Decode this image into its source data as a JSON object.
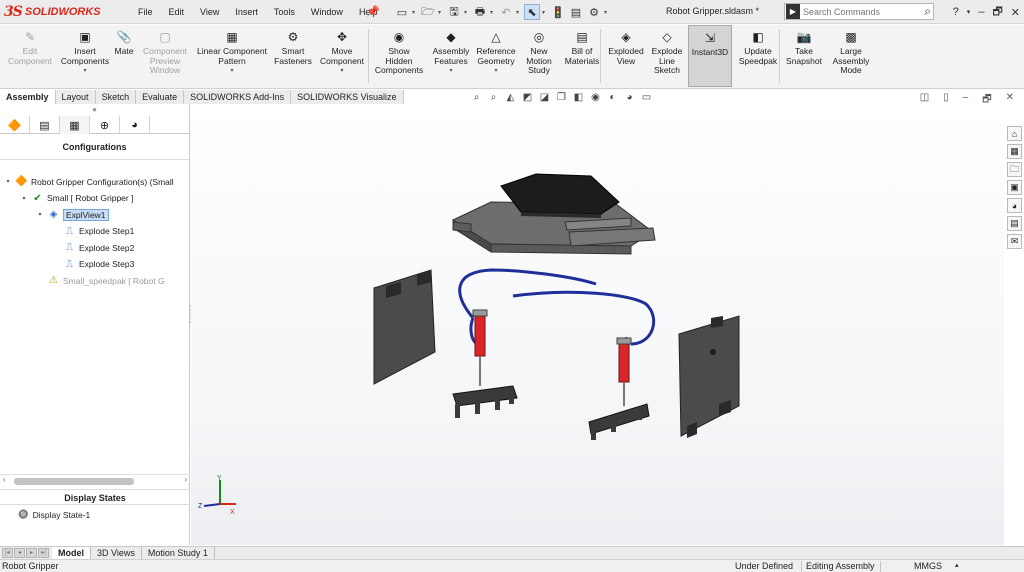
{
  "app": {
    "brand": "SOLIDWORKS",
    "document_title": "Robot Gripper.sldasm *"
  },
  "menu": [
    "File",
    "Edit",
    "View",
    "Insert",
    "Tools",
    "Window",
    "Help"
  ],
  "search": {
    "placeholder": "Search Commands"
  },
  "ribbon": [
    {
      "id": "edit-component",
      "label": "Edit Component",
      "lines": [
        "Edit",
        "Component"
      ],
      "disabled": true,
      "icon": "edit-component-icon"
    },
    {
      "id": "insert-components",
      "label": "Insert Components",
      "lines": [
        "Insert",
        "Components"
      ],
      "disabled": false,
      "icon": "insert-components-icon",
      "dropdown": true
    },
    {
      "id": "mate",
      "label": "Mate",
      "lines": [
        "Mate"
      ],
      "disabled": false,
      "icon": "paperclip-icon"
    },
    {
      "id": "component-preview",
      "label": "Component Preview Window",
      "lines": [
        "Component",
        "Preview",
        "Window"
      ],
      "disabled": true,
      "icon": "preview-window-icon"
    },
    {
      "id": "linear-pattern",
      "label": "Linear Component Pattern",
      "lines": [
        "Linear Component",
        "Pattern"
      ],
      "disabled": false,
      "icon": "linear-pattern-icon",
      "dropdown": true
    },
    {
      "id": "smart-fasteners",
      "label": "Smart Fasteners",
      "lines": [
        "Smart",
        "Fasteners"
      ],
      "disabled": false,
      "icon": "fastener-icon"
    },
    {
      "id": "move-component",
      "label": "Move Component",
      "lines": [
        "Move",
        "Component"
      ],
      "disabled": false,
      "icon": "move-component-icon",
      "dropdown": true
    },
    {
      "id": "show-hidden",
      "label": "Show Hidden Components",
      "lines": [
        "Show",
        "Hidden",
        "Components"
      ],
      "disabled": false,
      "icon": "show-hidden-icon"
    },
    {
      "id": "assembly-features",
      "label": "Assembly Features",
      "lines": [
        "Assembly",
        "Features"
      ],
      "disabled": false,
      "icon": "assembly-features-icon",
      "dropdown": true
    },
    {
      "id": "reference-geometry",
      "label": "Reference Geometry",
      "lines": [
        "Reference",
        "Geometry"
      ],
      "disabled": false,
      "icon": "reference-geometry-icon",
      "dropdown": true
    },
    {
      "id": "motion-study",
      "label": "New Motion Study",
      "lines": [
        "New",
        "Motion",
        "Study"
      ],
      "disabled": false,
      "icon": "motion-study-icon"
    },
    {
      "id": "bom",
      "label": "Bill of Materials",
      "lines": [
        "Bill of",
        "Materials"
      ],
      "disabled": false,
      "icon": "bill-of-materials-icon"
    },
    {
      "id": "exploded-view",
      "label": "Exploded View",
      "lines": [
        "Exploded",
        "View"
      ],
      "disabled": false,
      "icon": "exploded-view-icon"
    },
    {
      "id": "explode-line",
      "label": "Explode Line Sketch",
      "lines": [
        "Explode",
        "Line",
        "Sketch"
      ],
      "disabled": false,
      "icon": "explode-line-icon"
    },
    {
      "id": "instant3d",
      "label": "Instant3D",
      "lines": [
        "Instant3D"
      ],
      "disabled": false,
      "icon": "instant3d-icon",
      "active": true
    },
    {
      "id": "update-speedpak",
      "label": "Update Speedpak",
      "lines": [
        "Update",
        "Speedpak"
      ],
      "disabled": false,
      "icon": "speedpak-icon"
    },
    {
      "id": "take-snapshot",
      "label": "Take Snapshot",
      "lines": [
        "Take",
        "Snapshot"
      ],
      "disabled": false,
      "icon": "camera-icon"
    },
    {
      "id": "large-assembly",
      "label": "Large Assembly Mode",
      "lines": [
        "Large",
        "Assembly",
        "Mode"
      ],
      "disabled": false,
      "icon": "large-assembly-icon"
    }
  ],
  "command_tabs": [
    "Assembly",
    "Layout",
    "Sketch",
    "Evaluate",
    "SOLIDWORKS Add-Ins",
    "SOLIDWORKS Visualize"
  ],
  "active_command_tab": "Assembly",
  "left_panel": {
    "header": "Configurations",
    "tree": [
      {
        "label": "Robot Gripper Configuration(s)  (Small",
        "level": 0,
        "expanded": true,
        "icon": "assembly-icon"
      },
      {
        "label": "Small [ Robot Gripper ]",
        "level": 1,
        "expanded": true,
        "icon": "checkmark-icon"
      },
      {
        "label": "ExplView1",
        "level": 2,
        "expanded": true,
        "icon": "exploded-view-icon",
        "selected": true
      },
      {
        "label": "Explode Step1",
        "level": 3,
        "icon": "explode-step-icon"
      },
      {
        "label": "Explode Step2",
        "level": 3,
        "icon": "explode-step-icon"
      },
      {
        "label": "Explode Step3",
        "level": 3,
        "icon": "explode-step-icon"
      },
      {
        "label": "Small_speedpak [ Robot G",
        "level": 2,
        "icon": "speedpak-warning-icon",
        "dimmed": true
      }
    ],
    "display_states_header": "Display States",
    "display_state": "Display State-1"
  },
  "bottom_tabs": [
    "Model",
    "3D Views",
    "Motion Study 1"
  ],
  "active_bottom_tab": "Model",
  "status": {
    "left": "Robot Gripper",
    "definition": "Under Defined",
    "mode": "Editing Assembly",
    "units": "MMGS"
  },
  "colors": {
    "brand_red": "#d9271c",
    "cylinder_red": "#d8262a",
    "hose_blue": "#1f2e9b",
    "selection": "#c7dcf5"
  }
}
